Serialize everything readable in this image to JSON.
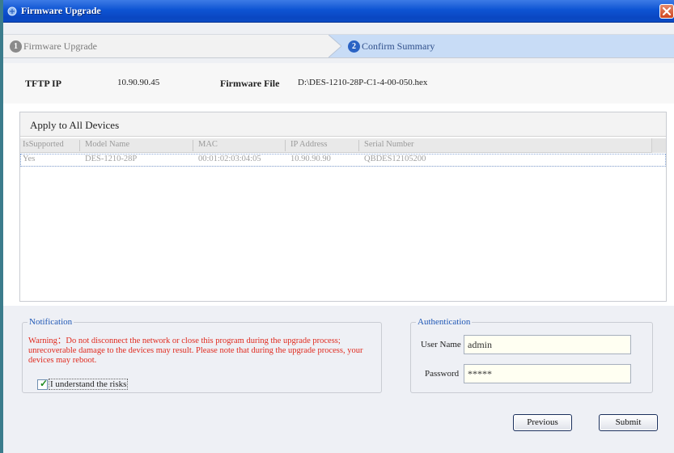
{
  "window": {
    "title": "Firmware Upgrade"
  },
  "steps": [
    {
      "number": "1",
      "label": "Firmware Upgrade"
    },
    {
      "number": "2",
      "label": "Confirm Summary"
    }
  ],
  "summary": {
    "tftp_label": "TFTP IP",
    "tftp_value": "10.90.90.45",
    "firmware_label": "Firmware File",
    "firmware_value": "D:\\DES-1210-28P-C1-4-00-050.hex"
  },
  "device_grid": {
    "title": "Apply to All Devices",
    "columns": [
      "IsSupported",
      "Model Name",
      "MAC",
      "IP Address",
      "Serial Number"
    ],
    "rows": [
      [
        "Yes",
        "DES-1210-28P",
        "00:01:02:03:04:05",
        "10.90.90.90",
        "QBDES12105200"
      ]
    ]
  },
  "notification": {
    "legend": "Notification",
    "warning": "Warning：Do not disconnect the network or close this program during the upgrade process; unrecoverable damage to the devices may result. Please note that during the upgrade process, your devices may reboot.",
    "checkbox_label": "I understand the risks",
    "checkbox_checked": true
  },
  "authentication": {
    "legend": "Authentication",
    "username_label": "User Name",
    "username_value": "admin",
    "password_label": "Password",
    "password_value": "*****"
  },
  "buttons": {
    "previous": "Previous",
    "submit": "Submit"
  },
  "colors": {
    "titlebar": "#0e54d3",
    "active_step": "#c8dcf6",
    "warning_text": "#e02a1e",
    "legend_text": "#1f57b5"
  }
}
